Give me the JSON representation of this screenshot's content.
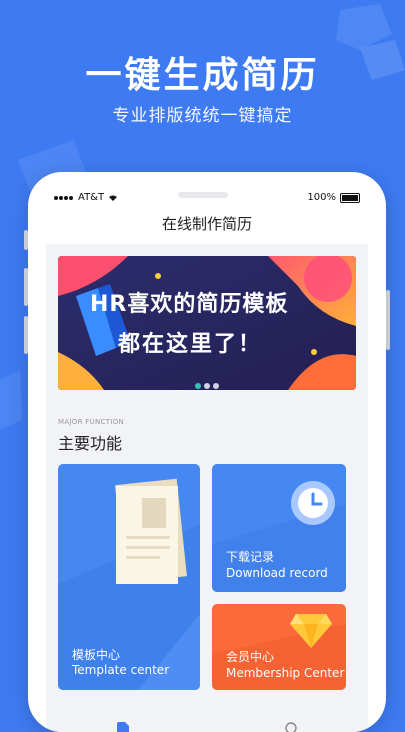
{
  "hero": {
    "title": "一键生成简历",
    "subtitle": "专业排版统统一键搞定"
  },
  "status_bar": {
    "carrier": "AT&T",
    "battery": "100%"
  },
  "nav": {
    "title": "在线制作简历"
  },
  "banner": {
    "line1": "HR喜欢的简历模板",
    "line2": "都在这里了！",
    "active_page": 0,
    "page_count": 3
  },
  "section": {
    "label_en": "MAJOR FUNCTION",
    "title": "主要功能"
  },
  "features": {
    "template": {
      "title": "模板中心",
      "subtitle": "Template center"
    },
    "download": {
      "title": "下载记录",
      "subtitle": "Download record"
    },
    "membership": {
      "title": "会员中心",
      "subtitle": "Membership Center"
    }
  },
  "colors": {
    "background": "#3E7BF2",
    "feature_blue": "#4688F1",
    "feature_orange": "#FB6A3A",
    "banner_dark": "#2b2b63"
  }
}
